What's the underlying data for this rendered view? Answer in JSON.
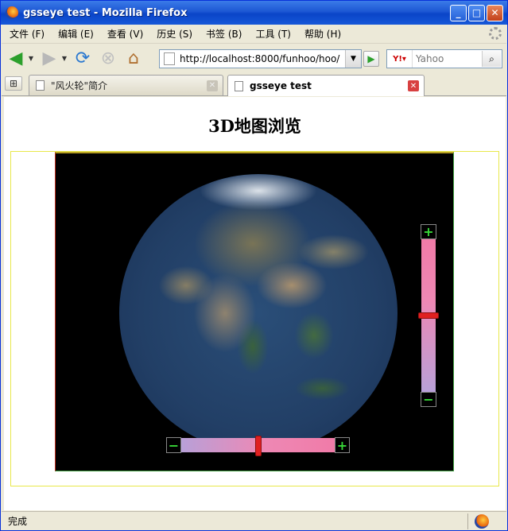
{
  "window": {
    "title": "gsseye test - Mozilla Firefox"
  },
  "menu": [
    {
      "label": "文件 (F)"
    },
    {
      "label": "编辑 (E)"
    },
    {
      "label": "查看 (V)"
    },
    {
      "label": "历史 (S)"
    },
    {
      "label": "书签 (B)"
    },
    {
      "label": "工具 (T)"
    },
    {
      "label": "帮助 (H)"
    }
  ],
  "nav": {
    "url": "http://localhost:8000/funhoo/hoo/",
    "search_placeholder": "Yahoo",
    "search_engine": "Y!"
  },
  "tabs": [
    {
      "label": "\"风火轮\"简介",
      "active": false
    },
    {
      "label": "gsseye test",
      "active": true
    }
  ],
  "page": {
    "title": "3D地图浏览"
  },
  "map": {
    "zoom_plus": "+",
    "zoom_minus": "−",
    "vertical_slider_level": 0.5,
    "horizontal_slider_level": 0.5
  },
  "status": {
    "text": "完成"
  },
  "colors": {
    "titlebar": "#0a44c8",
    "slider_thumb": "#e02020",
    "zoom_button_text": "#38d838",
    "frame_border": "#e8e84a"
  }
}
